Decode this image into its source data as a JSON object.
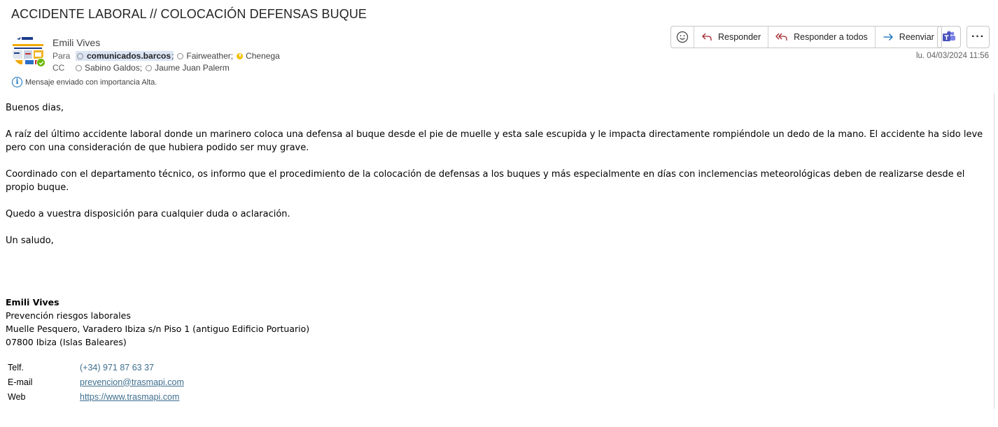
{
  "message": {
    "subject": "ACCIDENTE LABORAL // COLOCACIÓN DEFENSAS BUQUE",
    "sender": "Emili Vives",
    "to_label": "Para",
    "cc_label": "CC",
    "to": [
      {
        "name": "comunicados.barcos",
        "sep": ";",
        "presence": "offline"
      },
      {
        "name": "Fairweather",
        "sep": ";",
        "presence": "offline"
      },
      {
        "name": "Chenega",
        "sep": "",
        "presence": "away"
      }
    ],
    "cc": [
      {
        "name": "Sabino Galdos",
        "sep": ";",
        "presence": "offline"
      },
      {
        "name": "Jaume Juan Palerm",
        "sep": "",
        "presence": "offline"
      }
    ],
    "importance_notice": "Mensaje enviado con importancia Alta.",
    "date": "lu. 04/03/2024 11:56"
  },
  "toolbar": {
    "emoji_icon": "emoji-icon",
    "reply_label": "Responder",
    "reply_all_label": "Responder a todos",
    "forward_label": "Reenviar",
    "teams_icon": "teams-icon",
    "more_label": "···"
  },
  "body": {
    "greeting": "Buenos dias,",
    "paragraph1": "A raíz del último accidente laboral donde un marinero coloca una defensa al buque desde el pie de muelle y esta sale escupida y le impacta directamente rompiéndole un dedo de la mano. El accidente ha sido leve pero con una consideración de que hubiera podido ser muy grave.",
    "paragraph2": "Coordinado con el departamento técnico, os informo que el procedimiento de la colocación de defensas a los buques y más especialmente en días con inclemencias meteorológicas deben de realizarse desde el propio buque.",
    "paragraph3": "Quedo a vuestra disposición para cualquier duda o aclaración.",
    "closing": "Un saludo,"
  },
  "signature": {
    "name": "Emili Vives",
    "role": "Prevención riesgos laborales",
    "address1": "Muelle Pesquero, Varadero Ibiza s/n Piso 1 (antiguo Edificio Portuario)",
    "address2": "07800 Ibiza (Islas Baleares)",
    "contacts": [
      {
        "label": "Telf.",
        "value": "(+34) 971 87 63 37"
      },
      {
        "label": "E-mail",
        "value": "prevencion@trasmapi.com"
      },
      {
        "label": "Web",
        "value": "https://www.trasmapi.com"
      }
    ]
  },
  "colors": {
    "accent": "#0f6cbd",
    "reply_icon": "#a4262c",
    "presence_available": "#6bb700",
    "presence_away": "#f8c000",
    "link": "#3f6f8f"
  }
}
